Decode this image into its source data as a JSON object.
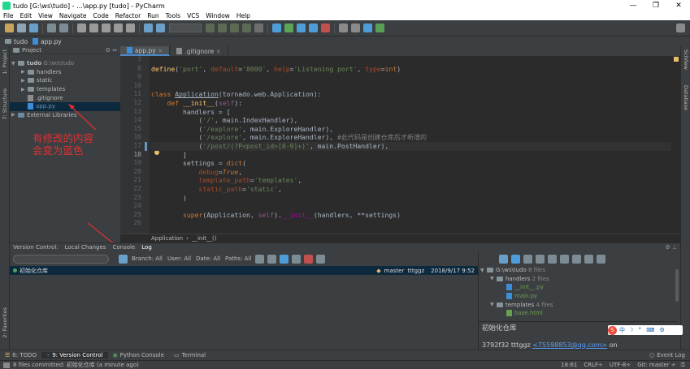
{
  "window": {
    "title": "tudo [G:\\ws\\tudo] - ...\\app.py [tudo] - PyCharm",
    "min": "—",
    "max": "❐",
    "close": "✕"
  },
  "menu": [
    "File",
    "Edit",
    "View",
    "Navigate",
    "Code",
    "Refactor",
    "Run",
    "Tools",
    "VCS",
    "Window",
    "Help"
  ],
  "nav": {
    "project": "tudo",
    "file": "app.py"
  },
  "left_strip": {
    "project": "1: Project",
    "structure": "7: Structure",
    "favorites": "2: Favorites"
  },
  "right_strip": {
    "sciview": "SciView",
    "database": "Database"
  },
  "project_panel": {
    "header": "Project",
    "items": [
      {
        "label": "tudo",
        "extra": "G:\\ws\\tudo",
        "type": "folder",
        "depth": 0,
        "expanded": "▼"
      },
      {
        "label": "handlers",
        "type": "folder",
        "depth": 1,
        "expanded": "▶"
      },
      {
        "label": "static",
        "type": "folder",
        "depth": 1,
        "expanded": "▶"
      },
      {
        "label": "templates",
        "type": "folder",
        "depth": 1,
        "expanded": "▶"
      },
      {
        "label": ".gitignore",
        "type": "git",
        "depth": 1,
        "expanded": ""
      },
      {
        "label": "app.py",
        "type": "py",
        "depth": 1,
        "expanded": "",
        "selected": true
      },
      {
        "label": "External Libraries",
        "type": "lib",
        "depth": 0,
        "expanded": "▶"
      }
    ]
  },
  "annotation": {
    "line1": "有修改的内容",
    "line2": "会变为蓝色"
  },
  "editor": {
    "tabs": [
      {
        "label": "app.py",
        "active": true
      },
      {
        "label": ".gitignore",
        "active": false
      }
    ],
    "line_numbers": [
      "7",
      "8",
      "9",
      "10",
      "11",
      "12",
      "13",
      "14",
      "15",
      "16",
      "17",
      "18",
      "19",
      "20",
      "21",
      "22",
      "23",
      "24",
      "25",
      "26"
    ],
    "breadcrumb": {
      "cls": "Application",
      "sep": "›",
      "fn": "__init__()"
    }
  },
  "vcs": {
    "tabs": [
      "Version Control:",
      "Local Changes",
      "Console",
      "Log"
    ],
    "active_tab": "Log",
    "filters": {
      "branch": "Branch: All",
      "user": "User: All",
      "date": "Date: All",
      "paths": "Paths: All"
    },
    "commit": {
      "message": "初始化仓库",
      "branch": "master",
      "author": "tttggz",
      "date": "2018/9/17 9:52"
    },
    "tree": {
      "root": "G:\\ws\\tudo",
      "root_count": "8 files",
      "handlers": "handlers",
      "handlers_count": "2 files",
      "init": "__init__.py",
      "main": "main.py",
      "templates": "templates",
      "templates_count": "4 files",
      "base": "base.html"
    },
    "detail_message": "初始化仓库",
    "detail_hash": "3792f32",
    "detail_author": "tttggz",
    "detail_email": "<75598853@qq.com>",
    "detail_on": "on"
  },
  "bottom_tabs": [
    "6: TODO",
    "9: Version Control",
    "Python Console",
    "Terminal"
  ],
  "event_log": "Event Log",
  "status": {
    "message": "8 files committed: 初始化仓库 (a minute ago)",
    "position": "18:61",
    "crlf": "CRLF÷",
    "encoding": "UTF-8÷",
    "git": "Git: master ÷"
  },
  "ime": {
    "logo": "S",
    "label": "中"
  }
}
